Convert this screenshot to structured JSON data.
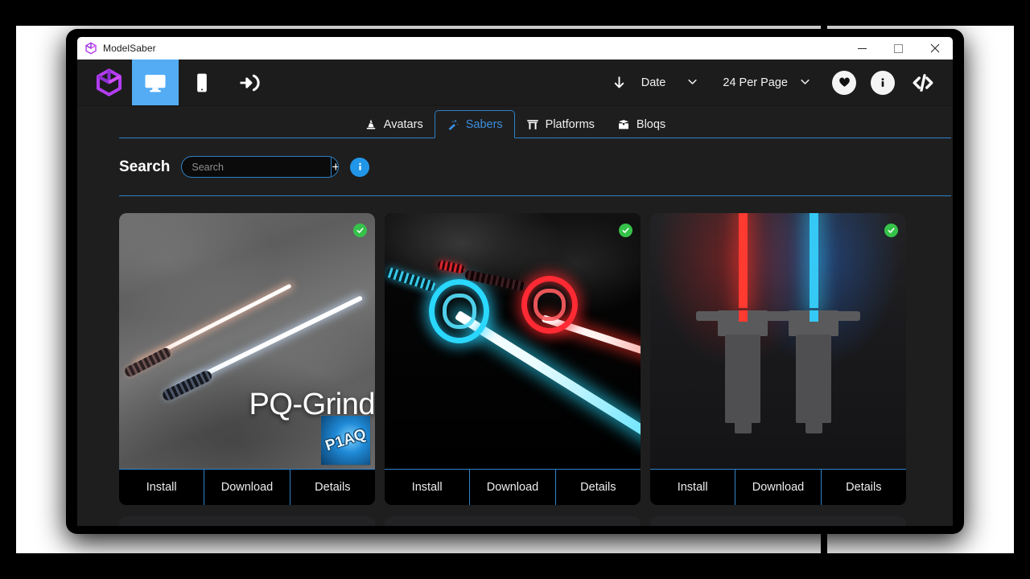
{
  "window": {
    "title": "ModelSaber",
    "app_icon": "cube-logo-icon",
    "minimize_label": "Minimize",
    "maximize_label": "Maximize",
    "close_label": "Close"
  },
  "topnav": {
    "logo_icon": "cube-logo-icon",
    "items": [
      {
        "icon": "cube-logo-icon",
        "name": "logo",
        "active": false
      },
      {
        "icon": "monitor-icon",
        "name": "desktop-view",
        "active": true
      },
      {
        "icon": "mobile-icon",
        "name": "mobile-view",
        "active": false
      },
      {
        "icon": "login-icon",
        "name": "login",
        "active": false
      }
    ],
    "sort_direction_icon": "arrow-down-icon",
    "sort_by": "Date",
    "per_page": "24 Per Page",
    "favorites_icon": "heart-icon",
    "info_icon": "info-icon",
    "code_icon": "code-icon"
  },
  "tabs": [
    {
      "label": "Avatars",
      "icon": "wizard-hat-icon",
      "active": false
    },
    {
      "label": "Sabers",
      "icon": "magic-wand-icon",
      "active": true
    },
    {
      "label": "Platforms",
      "icon": "torii-gate-icon",
      "active": false
    },
    {
      "label": "Bloqs",
      "icon": "box-icon",
      "active": false
    }
  ],
  "search": {
    "label": "Search",
    "placeholder": "Search",
    "value": "",
    "add_label": "+",
    "info_label": "i"
  },
  "cards": [
    {
      "title": "PQ-Grind",
      "author": "P1AQ",
      "verified": true,
      "thumb": "pq-grind-thumbnail",
      "buttons": {
        "install": "Install",
        "download": "Download",
        "details": "Details"
      }
    },
    {
      "title": "",
      "author": "",
      "verified": true,
      "thumb": "neon-cage-saber-thumbnail",
      "buttons": {
        "install": "Install",
        "download": "Download",
        "details": "Details"
      }
    },
    {
      "title": "",
      "author": "",
      "verified": true,
      "thumb": "default-saber-thumbnail",
      "buttons": {
        "install": "Install",
        "download": "Download",
        "details": "Details"
      }
    }
  ],
  "next_row_previews": 3,
  "colors": {
    "accent_blue": "#54acf5",
    "tab_border_blue": "#2e82c8",
    "tab_active_text": "#3b8fe0",
    "logo_purple": "#b23df0",
    "verified_green": "#36c24a",
    "info_blue": "#2196e8",
    "window_body": "#1e1e1e",
    "topnav_bg": "#1c1c1c",
    "card_bg": "#000000",
    "saber_red": "#ff3a30",
    "saber_blue": "#35c9f5"
  }
}
